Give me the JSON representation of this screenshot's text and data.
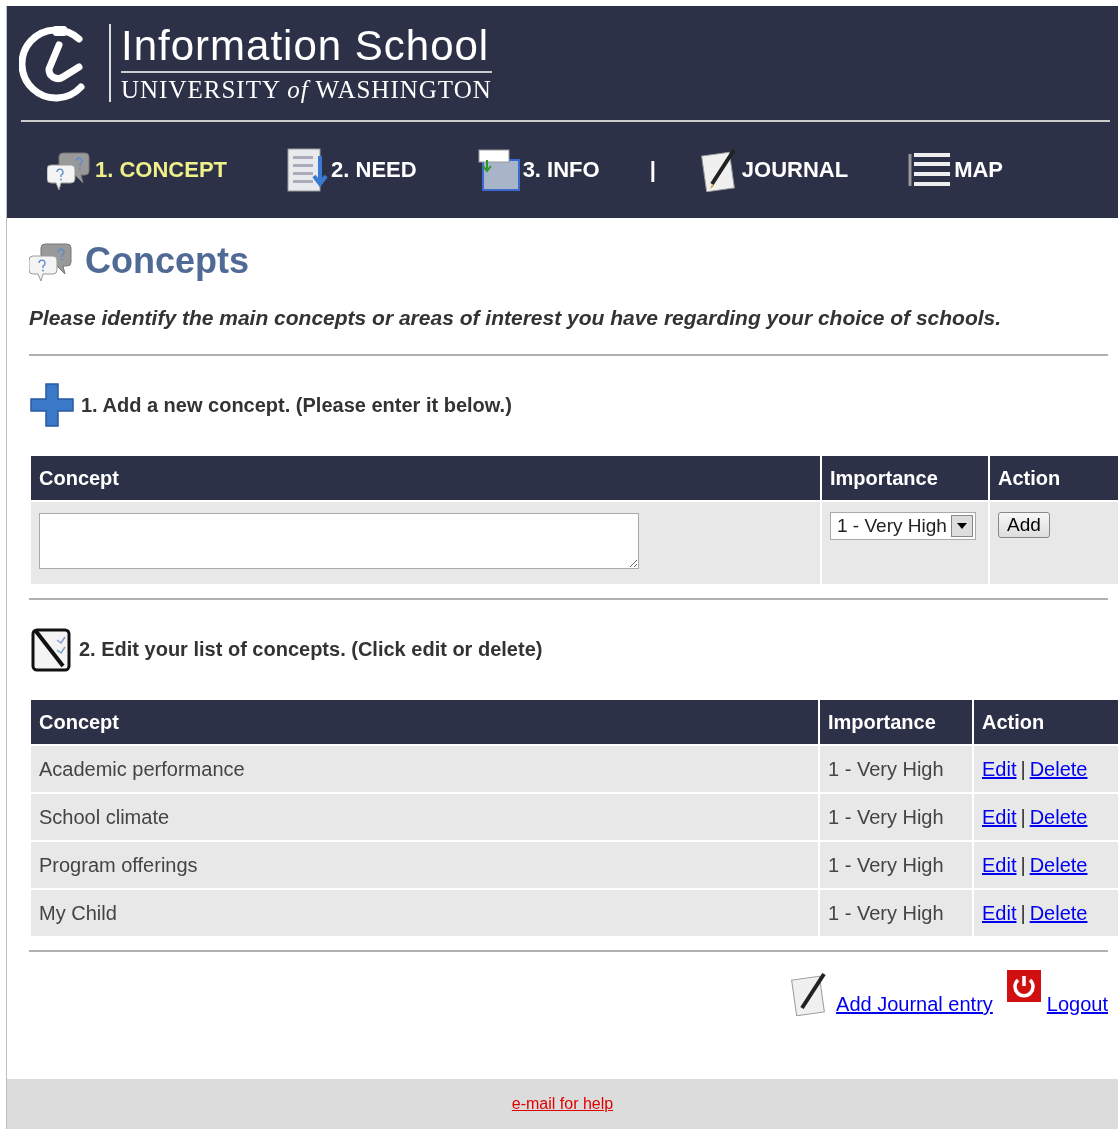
{
  "header": {
    "title": "Information School",
    "subtitle": "UNIVERSITY *of* WASHINGTON"
  },
  "nav": [
    {
      "kind": "concept",
      "label": "1. CONCEPT",
      "selected": true
    },
    {
      "kind": "need",
      "label": "2. NEED",
      "selected": false
    },
    {
      "kind": "info",
      "label": "3. INFO",
      "selected": false
    },
    {
      "kind": "separator",
      "label": "|"
    },
    {
      "kind": "journal",
      "label": "JOURNAL",
      "selected": false
    },
    {
      "kind": "map",
      "label": "MAP",
      "selected": false
    }
  ],
  "page": {
    "title": "Concepts",
    "intro": "Please identify the main concepts or areas of interest you have regarding your choice of schools."
  },
  "add_section": {
    "heading": "1. Add a new concept. (Please enter it below.)",
    "columns": [
      "Concept",
      "Importance",
      "Action"
    ],
    "importance_value": "1 - Very High",
    "button": "Add"
  },
  "edit_section": {
    "heading": "2. Edit your list of concepts. (Click edit or delete)",
    "columns": [
      "Concept",
      "Importance",
      "Action"
    ],
    "rows": [
      {
        "concept": "Academic performance",
        "importance": "1 - Very High",
        "edit": "Edit",
        "separator": "|",
        "delete": "Delete"
      },
      {
        "concept": "School climate",
        "importance": "1 - Very High",
        "edit": "Edit",
        "separator": "|",
        "delete": "Delete"
      },
      {
        "concept": "Program offerings",
        "importance": "1 - Very High",
        "edit": "Edit",
        "separator": "|",
        "delete": "Delete"
      },
      {
        "concept": "My Child",
        "importance": "1 - Very High",
        "edit": "Edit",
        "separator": "|",
        "delete": "Delete"
      }
    ]
  },
  "footer_links": {
    "journal": "Add Journal entry",
    "logout": "Logout"
  },
  "footer": {
    "help": "e-mail for help"
  }
}
